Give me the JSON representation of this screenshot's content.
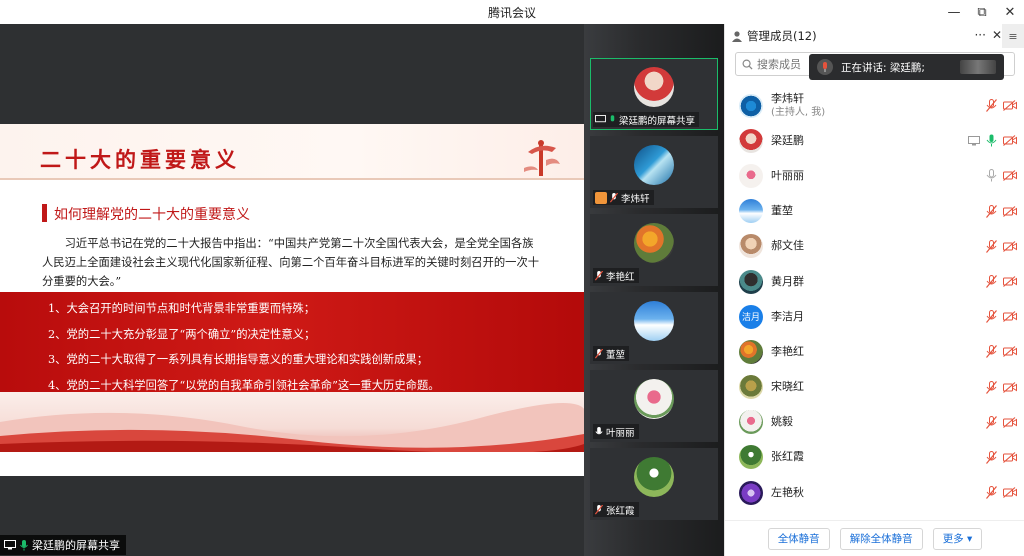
{
  "app": {
    "title": "腾讯会议"
  },
  "window": {
    "minimize": "—",
    "restore": "⧉",
    "close": "✕"
  },
  "slide": {
    "title": "二十大的重要意义",
    "subtitle": "如何理解党的二十大的重要意义",
    "paragraph": "习近平总书记在党的二十大报告中指出：“中国共产党第二十次全国代表大会，是全党全国各族人民迈上全面建设社会主义现代化国家新征程、向第二个百年奋斗目标进军的关键时刻召开的一次十分重要的大会。”",
    "points": [
      "1、大会召开的时间节点和时代背景非常重要而特殊；",
      "2、党的二十大充分彰显了“两个确立”的决定性意义；",
      "3、党的二十大取得了一系列具有长期指导意义的重大理论和实践创新成果；",
      "4、党的二十大科学回答了“以党的自我革命引领社会革命”这一重大历史命题。"
    ]
  },
  "share_label": "梁廷鹏的屏幕共享",
  "video_tiles": [
    {
      "name": "梁廷鹏的屏幕共享",
      "icon": "screen-share-icon",
      "mic": "mic-on-icon"
    },
    {
      "name": "李炜轩",
      "icon": "host-badge-icon",
      "mic": "mic-muted-icon"
    },
    {
      "name": "李艳红",
      "icon": "",
      "mic": "mic-muted-icon"
    },
    {
      "name": "董堃",
      "icon": "",
      "mic": "mic-muted-icon"
    },
    {
      "name": "叶丽丽",
      "icon": "",
      "mic": "mic-idle-icon"
    },
    {
      "name": "张红霞",
      "icon": "",
      "mic": "mic-muted-icon"
    }
  ],
  "panel": {
    "title": "管理成员(12)",
    "more": "···",
    "close": "✕",
    "menu": "≡",
    "search_placeholder": "搜索成员",
    "toast_text": "正在讲话: 梁廷鹏;",
    "members": [
      {
        "name": "李炜轩",
        "role": "(主持人, 我)",
        "mic": "muted",
        "cam": "off"
      },
      {
        "name": "梁廷鹏",
        "role": "",
        "mic": "on",
        "cam": "off",
        "screen": true
      },
      {
        "name": "叶丽丽",
        "role": "",
        "mic": "idle",
        "cam": "off"
      },
      {
        "name": "董堃",
        "role": "",
        "mic": "muted",
        "cam": "off"
      },
      {
        "name": "郝文佳",
        "role": "",
        "mic": "muted",
        "cam": "off"
      },
      {
        "name": "黄月群",
        "role": "",
        "mic": "muted",
        "cam": "off"
      },
      {
        "name": "李洁月",
        "role": "",
        "mic": "muted",
        "cam": "off",
        "avatar_text": "洁月"
      },
      {
        "name": "李艳红",
        "role": "",
        "mic": "muted",
        "cam": "off"
      },
      {
        "name": "宋晓红",
        "role": "",
        "mic": "muted",
        "cam": "off"
      },
      {
        "name": "姚毅",
        "role": "",
        "mic": "muted",
        "cam": "off"
      },
      {
        "name": "张红霞",
        "role": "",
        "mic": "muted",
        "cam": "off"
      },
      {
        "name": "左艳秋",
        "role": "",
        "mic": "muted",
        "cam": "off"
      }
    ],
    "footer": {
      "mute_all": "全体静音",
      "unmute_all": "解除全体静音",
      "more": "更多 ▾"
    }
  },
  "colors": {
    "accent_green": "#1bbc6a",
    "slide_red": "#c01818",
    "muted_red": "#e5533d",
    "link_blue": "#1a6fd8"
  }
}
